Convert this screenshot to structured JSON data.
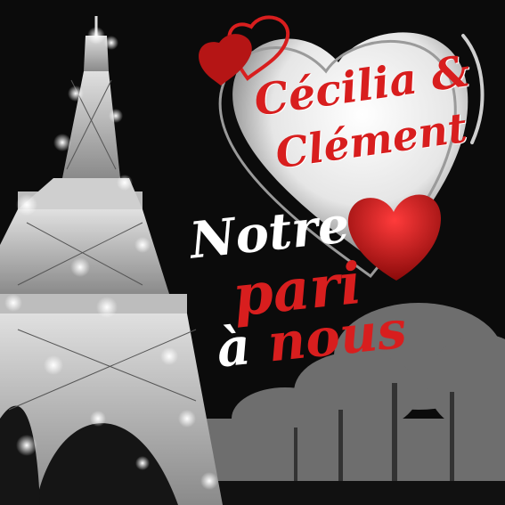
{
  "cover": {
    "artist_line1": "Cécilia &",
    "artist_line2": "Clément",
    "title_line1": "Notre",
    "title_line2": "pari",
    "title_line3_a": "à ",
    "title_line3_b": "nous"
  },
  "colors": {
    "background": "#0b0b0b",
    "accent_red": "#d81e1e",
    "white": "#ffffff",
    "grey": "#9a9a9a"
  },
  "icons": [
    "eiffel-tower-icon",
    "heart-icon",
    "tree-silhouette-icon",
    "sparkle-icon"
  ]
}
